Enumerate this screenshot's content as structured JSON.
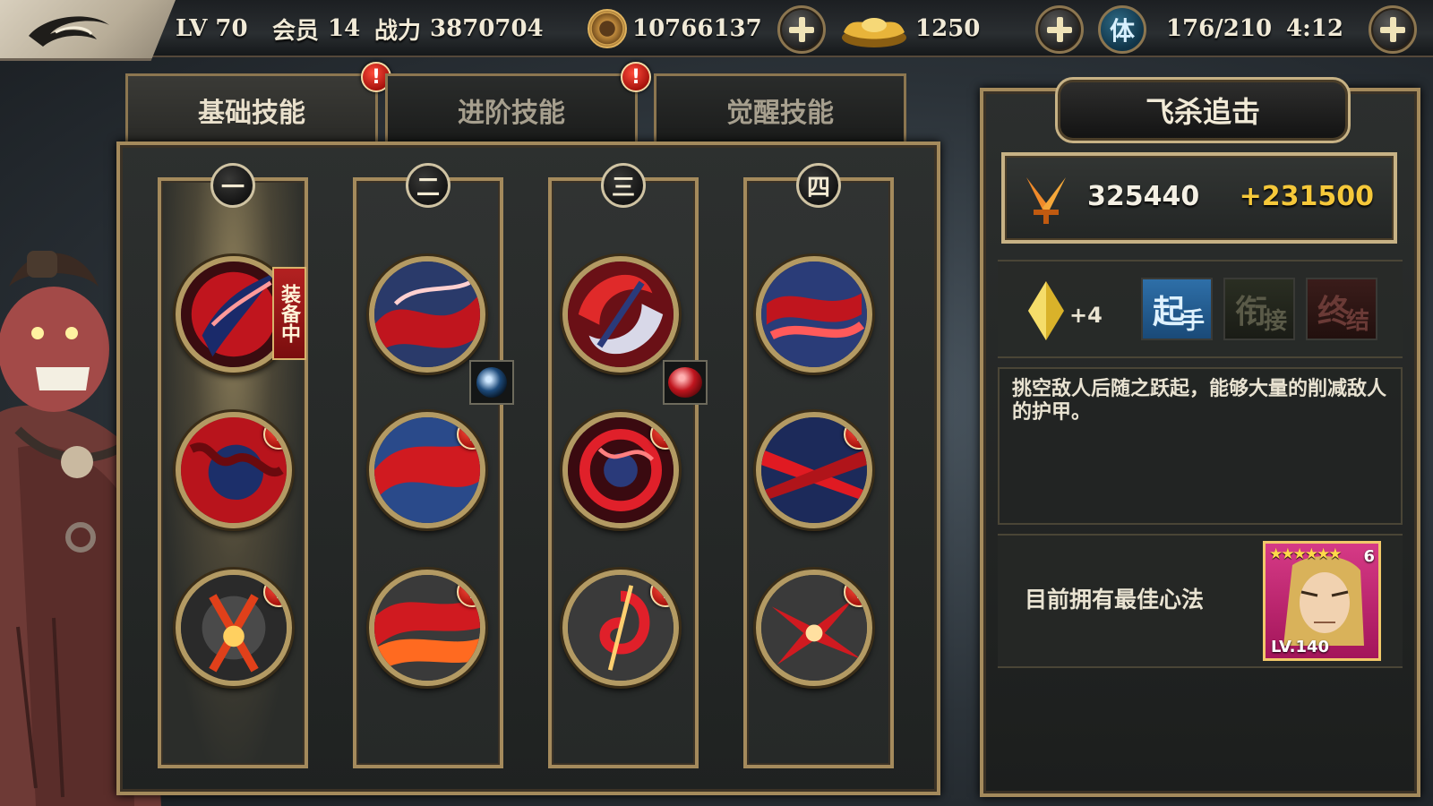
{
  "topbar": {
    "level": "LV 70",
    "vip_label": "会员",
    "vip_value": "14",
    "power_label": "战力",
    "power_value": "3870704",
    "coins": "10766137",
    "ingots": "1250",
    "stamina_icon_text": "体",
    "stamina": "176/210",
    "stamina_timer": "4:12"
  },
  "tabs": [
    {
      "label": "基础技能",
      "alert": "!"
    },
    {
      "label": "进阶技能",
      "alert": "!"
    },
    {
      "label": "觉醒技能"
    }
  ],
  "columns": [
    {
      "badge": "一"
    },
    {
      "badge": "二"
    },
    {
      "badge": "三"
    },
    {
      "badge": "四"
    }
  ],
  "equipped_label": "装备中",
  "alert_symbol": "!",
  "detail": {
    "skill_name": "飞杀追击",
    "power": "325440",
    "power_bonus": "+231500",
    "gem_bonus": "+4",
    "combo_tags": [
      {
        "main": "起",
        "sub": "手",
        "active": true
      },
      {
        "main": "衔",
        "sub": "接",
        "active": false
      },
      {
        "main": "终",
        "sub": "结",
        "active": false
      }
    ],
    "description": "挑空敌人后随之跃起，能够大量的削减敌人的护甲。",
    "heart_label": "目前拥有最佳心法",
    "hero_stars": "★★★★★★",
    "hero_awaken": "6",
    "hero_level": "LV.140"
  },
  "colors": {
    "gold_border": "#a48a5c",
    "alert_red": "#d6201a",
    "bonus_yellow": "#f5c83a",
    "active_combo_blue": "#2f8fd6"
  },
  "icons": {
    "back": "swirl-back-icon",
    "coin": "coin-icon",
    "ingot": "gold-ingot-icon",
    "power": "crossed-swords-icon",
    "gem": "diamond-gem-icon"
  }
}
